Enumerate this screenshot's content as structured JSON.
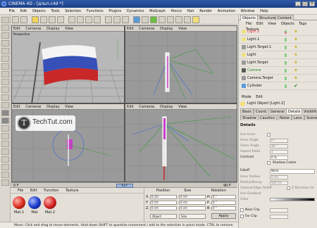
{
  "window": {
    "title": "CINEMA 4D - [дльп.c4d *]"
  },
  "menubar": [
    "File",
    "Edit",
    "Objects",
    "Tools",
    "Selection",
    "Functions",
    "Plugins",
    "Dynamics",
    "MoGraph",
    "Hocco",
    "Hair",
    "Render",
    "Animation",
    "Window",
    "Help"
  ],
  "viewports": {
    "menu": [
      "Edit",
      "Cameras",
      "Display",
      "View"
    ],
    "perspective_label": "Perspective"
  },
  "timeline": {
    "start": "0 F",
    "current": "63 F",
    "end": "90 F"
  },
  "materials": {
    "menu": [
      "File",
      "Edit",
      "Function",
      "Texture"
    ],
    "items": [
      {
        "label": "Mat.1",
        "color": "#d8281c"
      },
      {
        "label": "Mat",
        "color": "#1838c8"
      },
      {
        "label": "Mat.2",
        "color": "#d02020"
      }
    ]
  },
  "coordinates": {
    "headers": {
      "position": "Position",
      "size": "Size",
      "rotation": "Rotation"
    },
    "rows": [
      {
        "axis": "X",
        "pos": "0 cm",
        "size": "0 cm",
        "rot_axis": "H",
        "rot": "0 °"
      },
      {
        "axis": "Y",
        "pos": "0 cm",
        "size": "0 cm",
        "rot_axis": "P",
        "rot": "0 °"
      },
      {
        "axis": "Z",
        "pos": "0 cm",
        "size": "0 cm",
        "rot_axis": "B",
        "rot": "0 °"
      }
    ],
    "mode_object": "Object",
    "mode_size": "Size",
    "apply": "Apply"
  },
  "status": "Move: Click and drag to move elements. Hold down SHIFT to quantize movement / add to the selection in point mode, CTRL to remove.",
  "object_manager": {
    "tabs": [
      "Objects",
      "Structure",
      "Content"
    ],
    "menu": [
      "File",
      "Edit",
      "View",
      "Objects",
      "Tags",
      "Texture"
    ],
    "items": [
      {
        "name": "Light.2",
        "selected": true
      },
      {
        "name": "Light.1",
        "selected": false
      },
      {
        "name": "Light.Target.1",
        "selected": false
      },
      {
        "name": "Light",
        "selected": false
      },
      {
        "name": "Light.Target",
        "selected": false
      },
      {
        "name": "Camera",
        "selected": false
      },
      {
        "name": "Camera.Target",
        "selected": false
      },
      {
        "name": "Cylinder",
        "selected": false
      }
    ]
  },
  "attributes": {
    "menu": [
      "Mode",
      "Edit"
    ],
    "object_title": "Light Object [Light.2]",
    "tabs_row1": [
      "Basic",
      "Coord.",
      "General",
      "Details",
      "Visibility"
    ],
    "tabs_row2": [
      "Shadow",
      "Caustics",
      "Noise",
      "Lens",
      "Scene"
    ],
    "section": "Details",
    "fields": [
      {
        "label": "Use Inner",
        "value": ""
      },
      {
        "label": "Inner Angle",
        "value": "0 °"
      },
      {
        "label": "Outer Angle",
        "value": "30 °"
      },
      {
        "label": "Aspect Ratio",
        "value": "1"
      },
      {
        "label": "Contrast",
        "value": "0 %"
      },
      {
        "label": "Shadow Caster",
        "value": ""
      }
    ],
    "falloff": {
      "label": "Falloff",
      "value": "None"
    },
    "falloff_fields": [
      {
        "label": "Inner Radius",
        "value": "0 cm"
      },
      {
        "label": "Radius/Decay",
        "value": "500 cm"
      },
      {
        "label": "Colored Edge Falloff",
        "value": ""
      },
      {
        "label": "Use Gradient",
        "value": ""
      },
      {
        "label": "Color",
        "value": ""
      }
    ],
    "z_direction": "Z Direction Or",
    "near_clip": "Near Clip",
    "far_clip": "Far Clip"
  },
  "watermark": {
    "text": "TechTut.com"
  }
}
